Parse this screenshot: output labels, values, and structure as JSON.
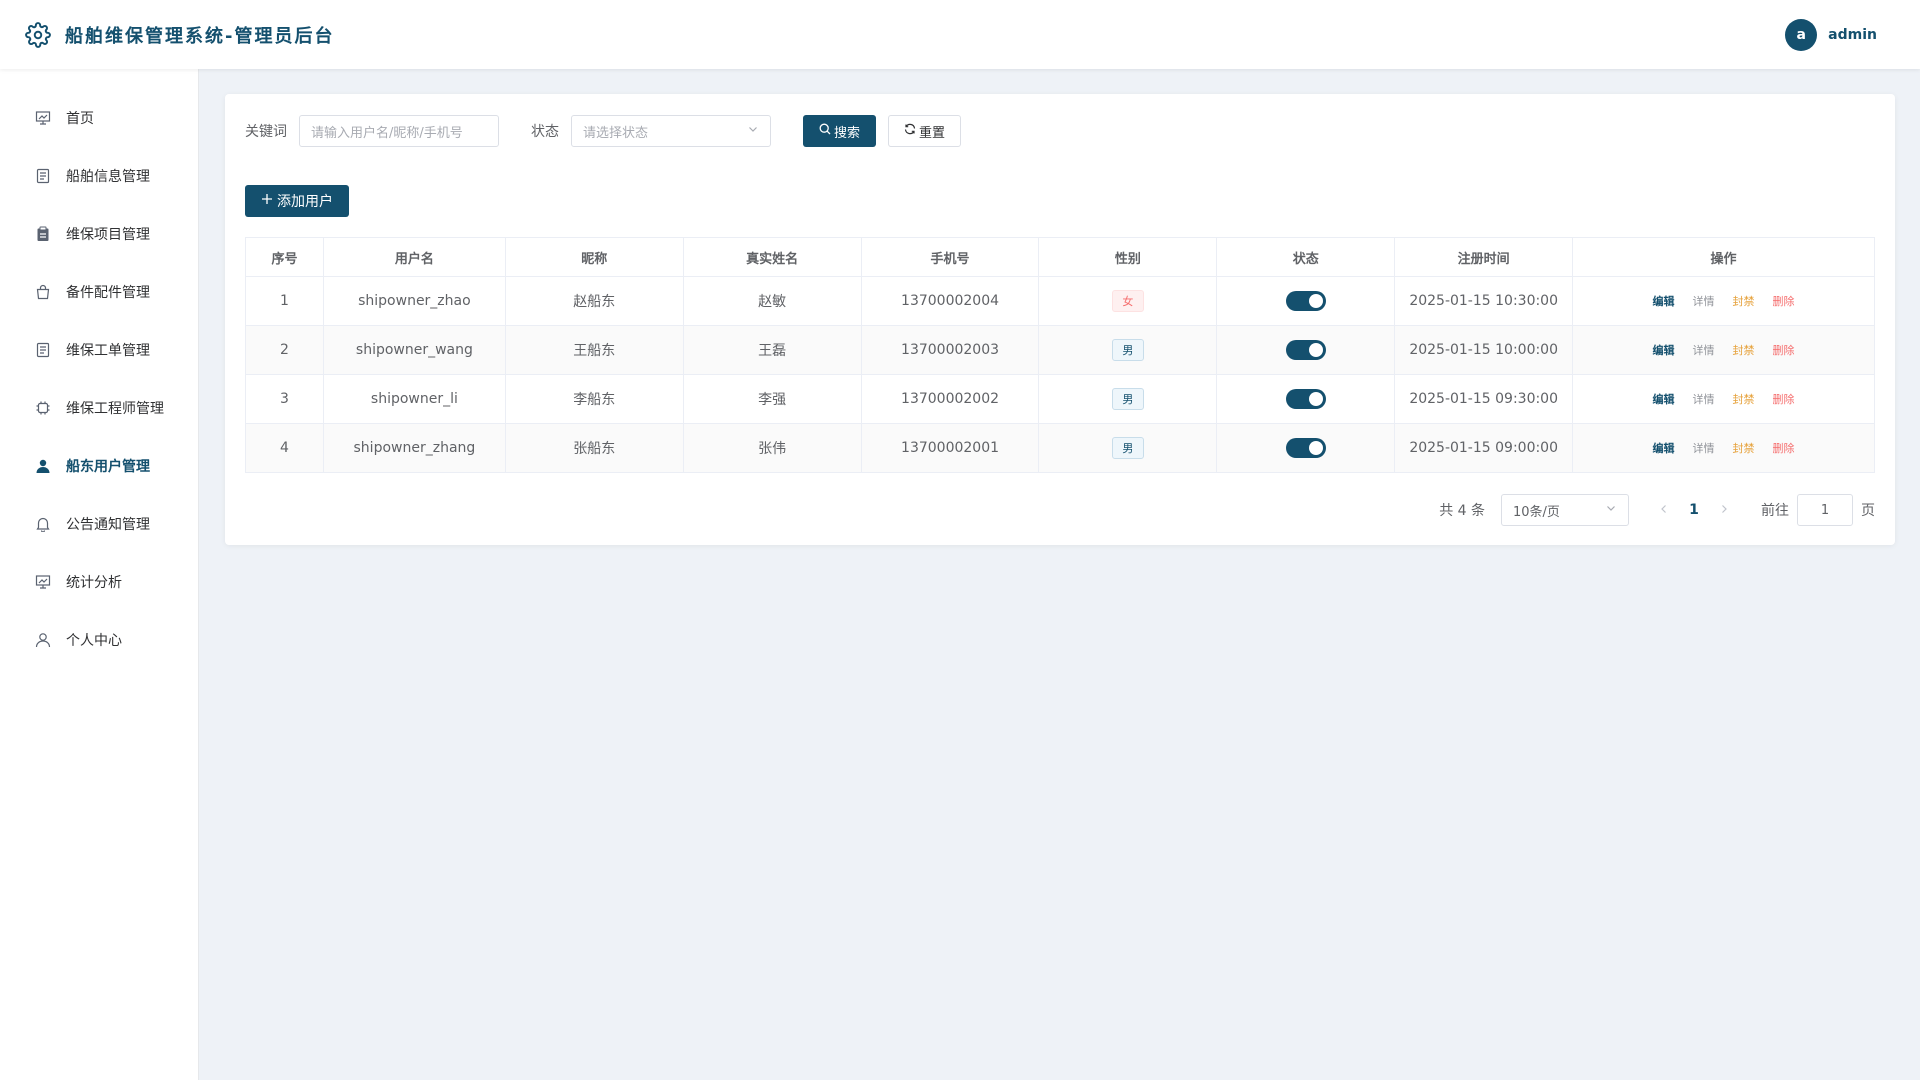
{
  "header": {
    "title": "船舶维保管理系统-管理员后台",
    "avatar_letter": "a",
    "username": "admin"
  },
  "sidebar": {
    "items": [
      {
        "label": "首页",
        "icon": "dashboard-icon"
      },
      {
        "label": "船舶信息管理",
        "icon": "document-icon"
      },
      {
        "label": "维保项目管理",
        "icon": "clipboard-icon"
      },
      {
        "label": "备件配件管理",
        "icon": "bag-icon"
      },
      {
        "label": "维保工单管理",
        "icon": "document-icon"
      },
      {
        "label": "维保工程师管理",
        "icon": "cpu-icon"
      },
      {
        "label": "船东用户管理",
        "icon": "user-filled-icon",
        "active": true
      },
      {
        "label": "公告通知管理",
        "icon": "bell-icon"
      },
      {
        "label": "统计分析",
        "icon": "chart-icon"
      },
      {
        "label": "个人中心",
        "icon": "user-icon"
      }
    ]
  },
  "filters": {
    "keyword_label": "关键词",
    "keyword_placeholder": "请输入用户名/昵称/手机号",
    "status_label": "状态",
    "status_placeholder": "请选择状态",
    "search_label": "搜索",
    "reset_label": "重置"
  },
  "add_button_label": "添加用户",
  "table": {
    "columns": [
      "序号",
      "用户名",
      "昵称",
      "真实姓名",
      "手机号",
      "性别",
      "状态",
      "注册时间",
      "操作"
    ],
    "rows": [
      {
        "index": "1",
        "username": "shipowner_zhao",
        "nickname": "赵船东",
        "realname": "赵敏",
        "phone": "13700002004",
        "gender": "女",
        "enabled": true,
        "registered": "2025-01-15 10:30:00"
      },
      {
        "index": "2",
        "username": "shipowner_wang",
        "nickname": "王船东",
        "realname": "王磊",
        "phone": "13700002003",
        "gender": "男",
        "enabled": true,
        "registered": "2025-01-15 10:00:00"
      },
      {
        "index": "3",
        "username": "shipowner_li",
        "nickname": "李船东",
        "realname": "李强",
        "phone": "13700002002",
        "gender": "男",
        "enabled": true,
        "registered": "2025-01-15 09:30:00"
      },
      {
        "index": "4",
        "username": "shipowner_zhang",
        "nickname": "张船东",
        "realname": "张伟",
        "phone": "13700002001",
        "gender": "男",
        "enabled": true,
        "registered": "2025-01-15 09:00:00"
      }
    ],
    "actions": {
      "edit": "编辑",
      "detail": "详情",
      "ban": "封禁",
      "delete": "删除"
    }
  },
  "pagination": {
    "total_text": "共 4 条",
    "page_size": "10条/页",
    "current_page": "1",
    "goto_label": "前往",
    "goto_value": "1",
    "goto_suffix": "页"
  },
  "colors": {
    "primary": "#14506e",
    "danger": "#f56c6c",
    "warning": "#e6a23c",
    "background": "#eef2f7"
  }
}
